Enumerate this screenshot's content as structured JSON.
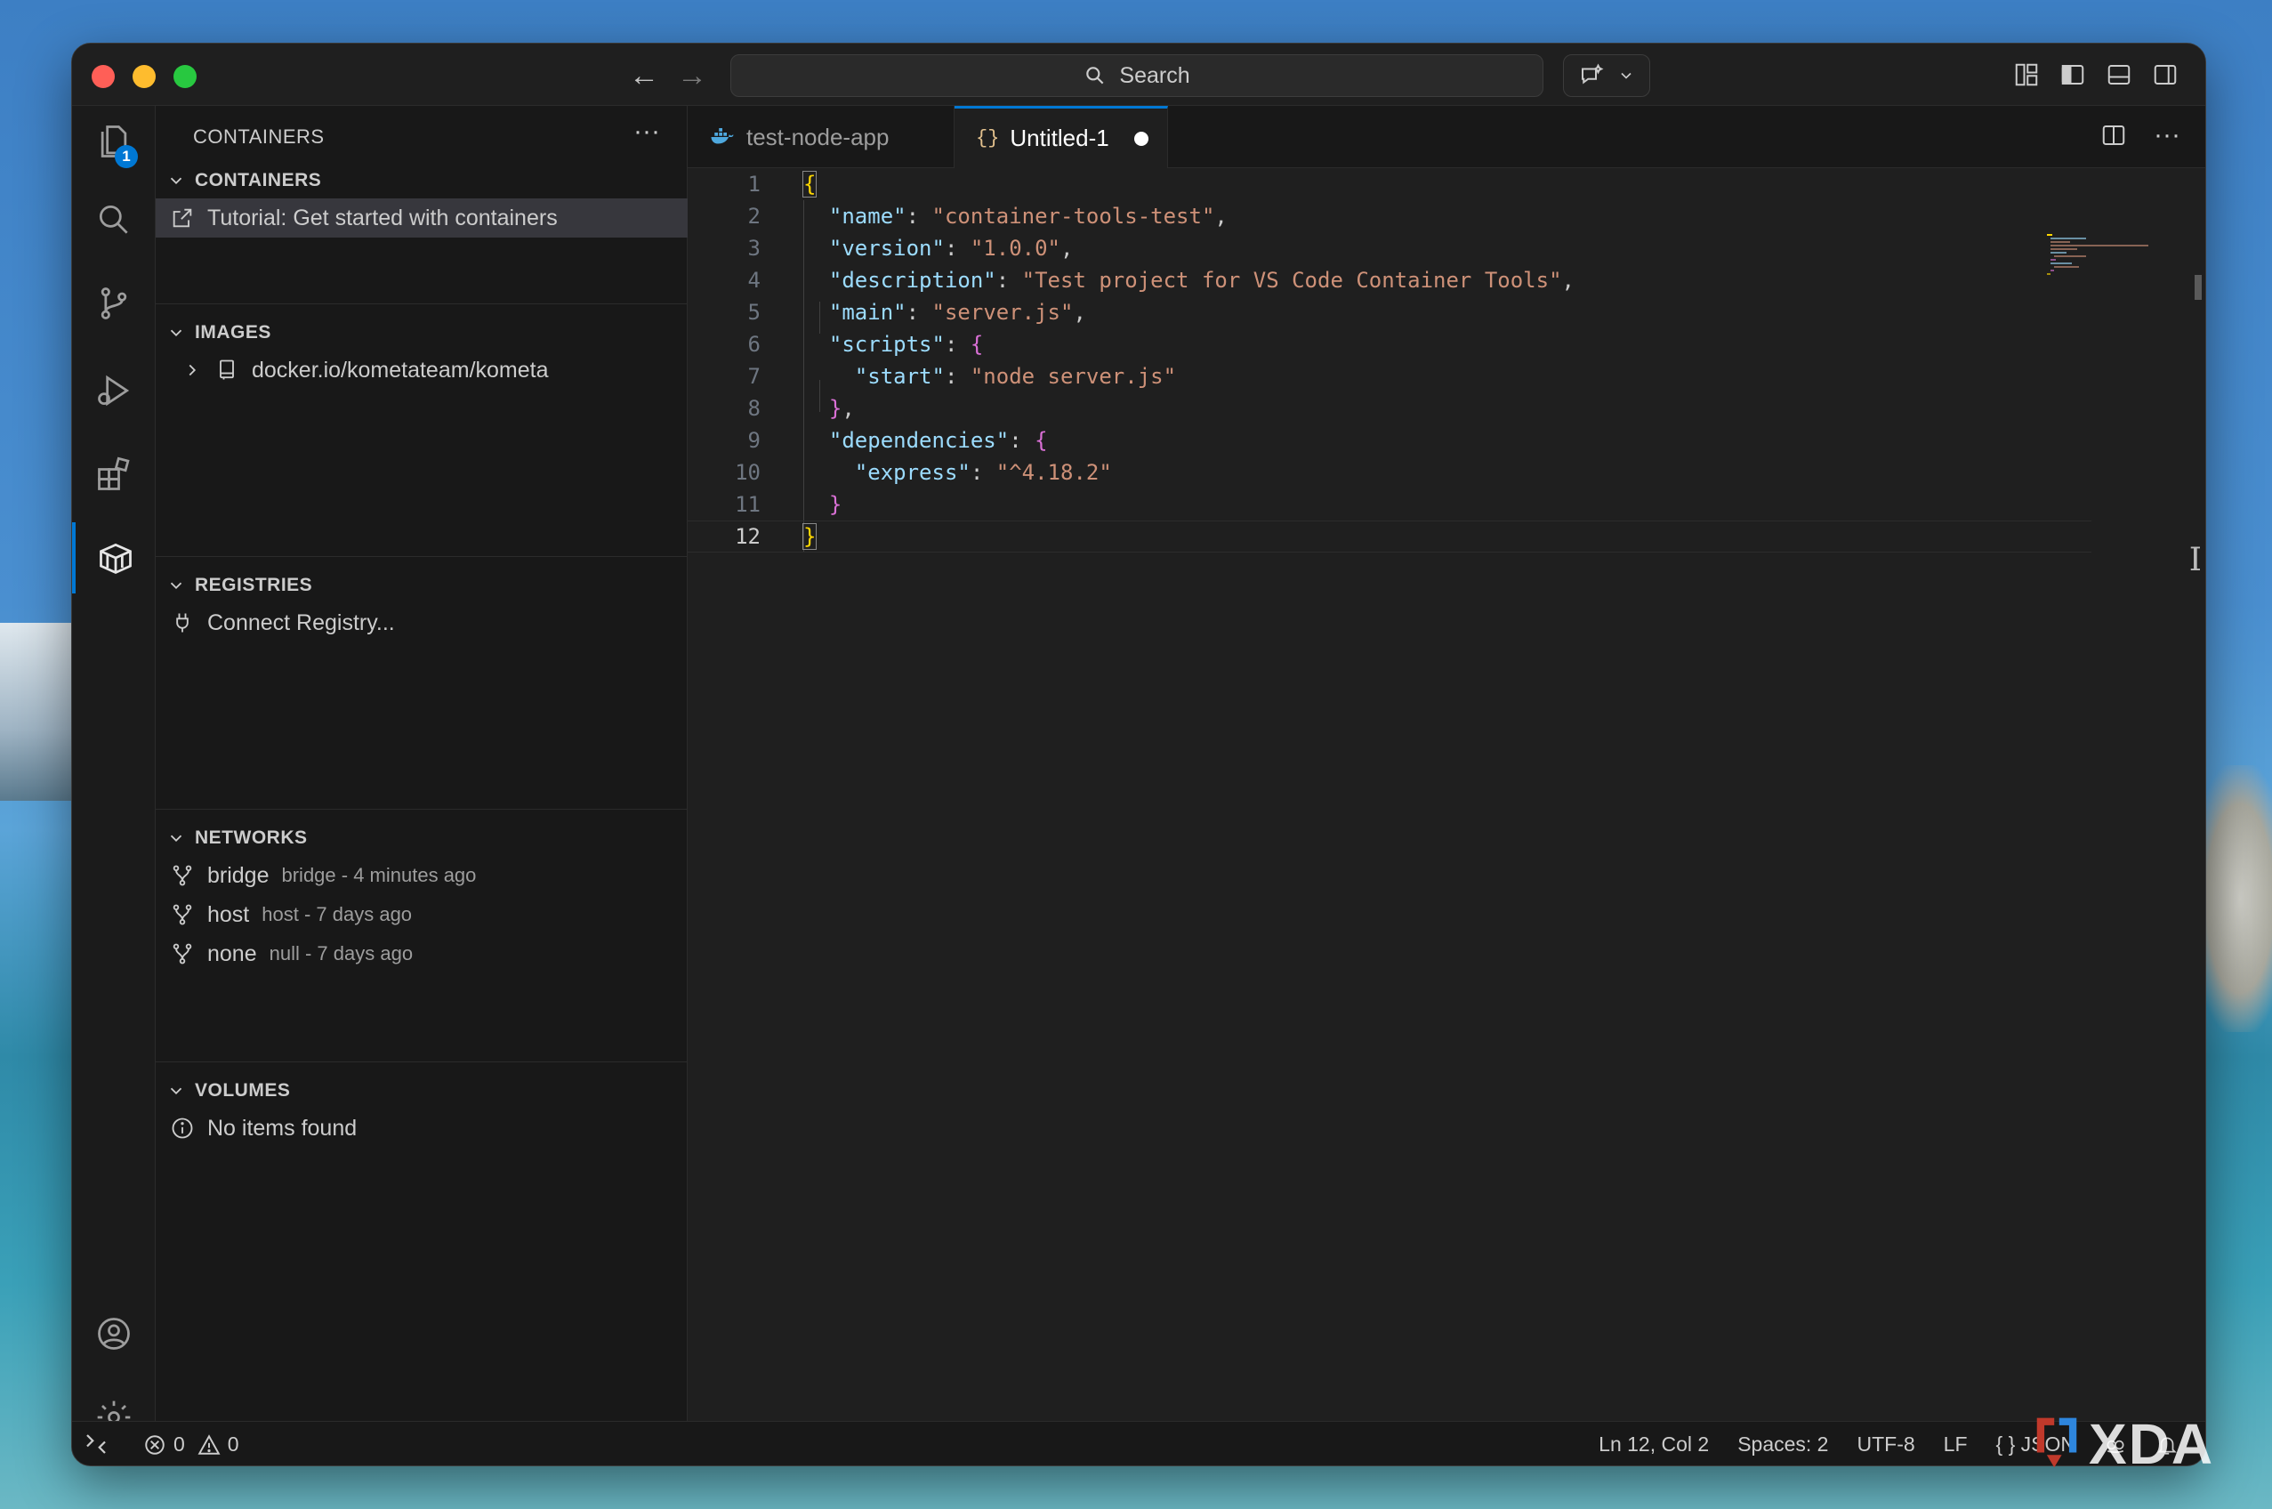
{
  "titlebar": {
    "search_label": "Search"
  },
  "activity": {
    "explorer_badge": "1"
  },
  "sidebar": {
    "title": "CONTAINERS",
    "sections": {
      "containers": {
        "header": "CONTAINERS",
        "items": [
          {
            "label": "Tutorial: Get started with containers"
          }
        ]
      },
      "images": {
        "header": "IMAGES",
        "items": [
          {
            "label": "docker.io/kometateam/kometa"
          }
        ]
      },
      "registries": {
        "header": "REGISTRIES",
        "items": [
          {
            "label": "Connect Registry..."
          }
        ]
      },
      "networks": {
        "header": "NETWORKS",
        "items": [
          {
            "label": "bridge",
            "desc": "bridge - 4 minutes ago"
          },
          {
            "label": "host",
            "desc": "host - 7 days ago"
          },
          {
            "label": "none",
            "desc": "null - 7 days ago"
          }
        ]
      },
      "volumes": {
        "header": "VOLUMES",
        "items": [
          {
            "label": "No items found"
          }
        ]
      }
    }
  },
  "tabs": [
    {
      "label": "test-node-app",
      "icon": "docker-icon"
    },
    {
      "label": "Untitled-1",
      "icon": "json-braces-icon",
      "modified": true,
      "braces": "{}"
    }
  ],
  "editor": {
    "line_numbers": [
      "1",
      "2",
      "3",
      "4",
      "5",
      "6",
      "7",
      "8",
      "9",
      "10",
      "11",
      "12"
    ],
    "lines": {
      "l1": {
        "open": "{"
      },
      "l2": {
        "key": "\"name\"",
        "colon": ": ",
        "value": "\"container-tools-test\"",
        "comma": ","
      },
      "l3": {
        "key": "\"version\"",
        "colon": ": ",
        "value": "\"1.0.0\"",
        "comma": ","
      },
      "l4": {
        "key": "\"description\"",
        "colon": ": ",
        "value": "\"Test project for VS Code Container Tools\"",
        "comma": ","
      },
      "l5": {
        "key": "\"main\"",
        "colon": ": ",
        "value": "\"server.js\"",
        "comma": ","
      },
      "l6": {
        "key": "\"scripts\"",
        "colon": ": ",
        "open": "{"
      },
      "l7": {
        "key": "\"start\"",
        "colon": ": ",
        "value": "\"node server.js\""
      },
      "l8": {
        "close": "}",
        "comma": ","
      },
      "l9": {
        "key": "\"dependencies\"",
        "colon": ": ",
        "open": "{"
      },
      "l10": {
        "key": "\"express\"",
        "colon": ": ",
        "value": "\"^4.18.2\""
      },
      "l11": {
        "close": "}"
      },
      "l12": {
        "close": "}"
      }
    }
  },
  "statusbar": {
    "errors": "0",
    "warnings": "0",
    "position": "Ln 12, Col 2",
    "spaces": "Spaces: 2",
    "encoding": "UTF-8",
    "eol": "LF",
    "language_braces": "{ }",
    "language": "JSON"
  },
  "watermark": "XDA",
  "colors": {
    "accent": "#0078d4",
    "json_key": "#9cdcfe",
    "json_string": "#ce9178",
    "bracket_level1": "#ffd700",
    "bracket_level2": "#da70d6"
  }
}
